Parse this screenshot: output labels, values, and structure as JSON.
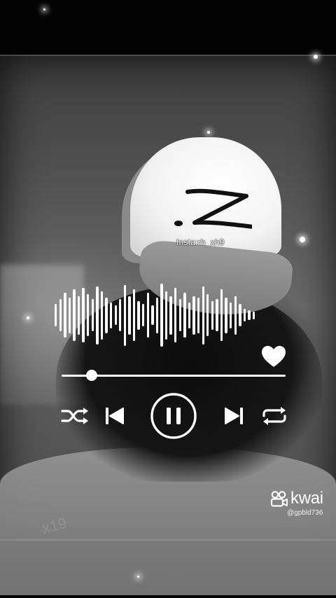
{
  "cap": {
    "handle_text": "Insta:rh_xh9"
  },
  "waveform": {
    "levels": [
      0.35,
      0.5,
      0.7,
      0.55,
      0.8,
      0.6,
      0.85,
      0.65,
      0.5,
      0.9,
      0.75,
      0.55,
      0.4,
      0.3,
      0.5,
      0.95,
      0.6,
      0.8,
      0.45,
      0.35,
      0.7,
      0.3,
      0.55,
      0.98,
      0.75,
      0.6,
      0.85,
      0.5,
      0.7,
      0.4,
      0.6,
      0.55,
      0.9,
      0.65,
      0.45,
      0.5,
      0.8,
      0.55,
      0.4,
      0.6,
      0.35,
      0.2,
      0.15,
      0.12
    ]
  },
  "player": {
    "progress": 0.135,
    "state": "playing",
    "icons": {
      "like": "heart-icon",
      "shuffle": "shuffle-icon",
      "previous": "skip-previous-icon",
      "pause": "pause-icon",
      "next": "skip-next-icon",
      "repeat": "repeat-icon"
    }
  },
  "branding": {
    "app_name": "kwai",
    "username": "@gpbld736",
    "watermark": "x19"
  },
  "colors": {
    "foreground": "#ffffff",
    "background": "#030303"
  }
}
